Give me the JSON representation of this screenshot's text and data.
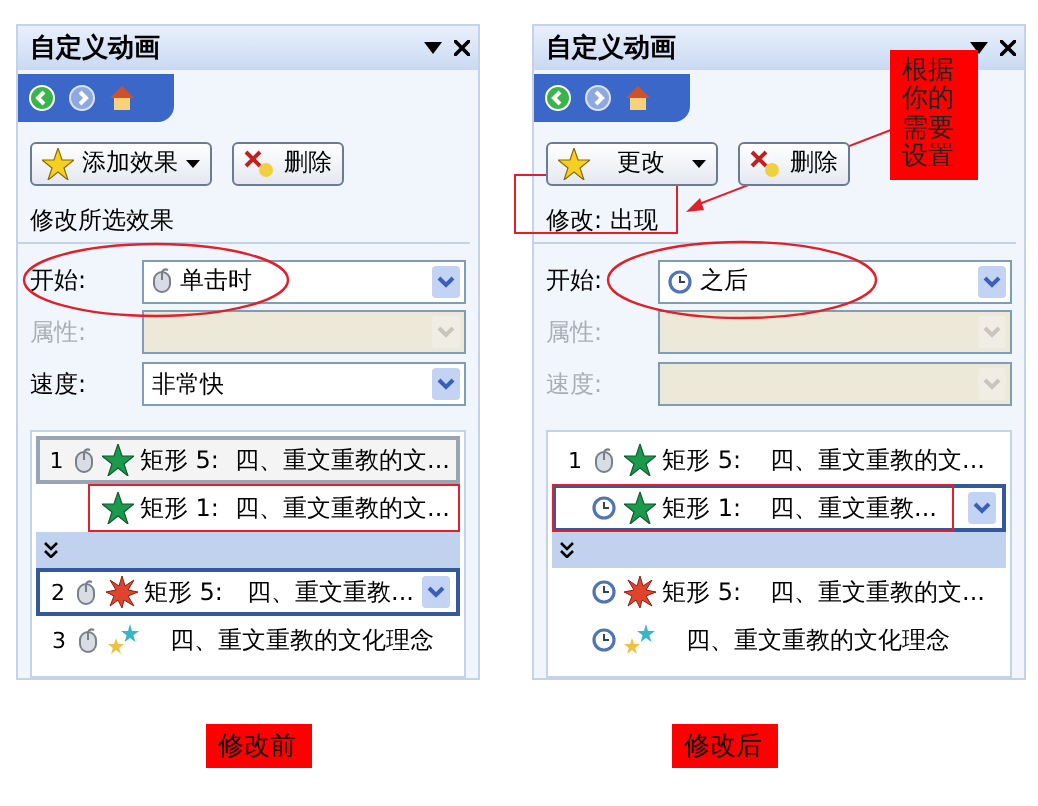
{
  "panels": [
    {
      "title": "自定义动画",
      "add_button": "添加效果",
      "delete_button": "删除",
      "section_label": {
        "text": "修改所选效果",
        "boxed": false
      },
      "fields": [
        {
          "label": "开始:",
          "value": "单击时",
          "disabled": false,
          "circled": true
        },
        {
          "label": "属性:",
          "disabled": true,
          "circled": false
        },
        {
          "label": "速度:",
          "value": "非常快",
          "disabled": false,
          "circled": false
        }
      ],
      "items": [
        {
          "kind": "click",
          "number": "1",
          "shape": "矩形 5:",
          "text": "四、重文重教的文...",
          "outlined": true,
          "selected": false,
          "boxed": false
        },
        {
          "kind": "with",
          "shape": "矩形 1:",
          "text": "四、重文重教的文...",
          "outlined": false,
          "selected": false,
          "boxed": true
        },
        {
          "kind": "expander"
        },
        {
          "kind": "click",
          "number": "2",
          "shape": "矩形 5:",
          "text": "四、重文重教...",
          "outlined": true,
          "selected": true,
          "boxed": false
        },
        {
          "kind": "click",
          "number": "3",
          "text": "四、重文重教的文化理念",
          "outlined": false,
          "selected": false,
          "boxed": false
        }
      ],
      "caption": "修改前"
    },
    {
      "title": "自定义动画",
      "add_button": "更改",
      "delete_button": "删除",
      "section_label": {
        "text": "修改: 出现",
        "boxed": true
      },
      "note": "根据你的需要设置",
      "fields": [
        {
          "label": "开始:",
          "value": "之后",
          "disabled": false,
          "circled": true
        },
        {
          "label": "属性:",
          "disabled": true,
          "circled": false
        },
        {
          "label": "速度:",
          "disabled": true,
          "circled": false
        }
      ],
      "items": [
        {
          "kind": "click",
          "number": "1",
          "shape": "矩形 5:",
          "text": "四、重文重教的文...",
          "outlined": false,
          "selected": false,
          "boxed": false
        },
        {
          "kind": "after",
          "shape": "矩形 1:",
          "text": "四、重文重教...",
          "outlined": false,
          "selected": true,
          "boxed": true
        },
        {
          "kind": "expander"
        },
        {
          "kind": "after",
          "shape": "矩形 5:",
          "text": "四、重文重教的文...",
          "outlined": false,
          "selected": false,
          "boxed": false
        },
        {
          "kind": "after",
          "text": "四、重文重教的文化理念",
          "outlined": false,
          "selected": false,
          "boxed": false
        }
      ],
      "caption": "修改后"
    }
  ]
}
